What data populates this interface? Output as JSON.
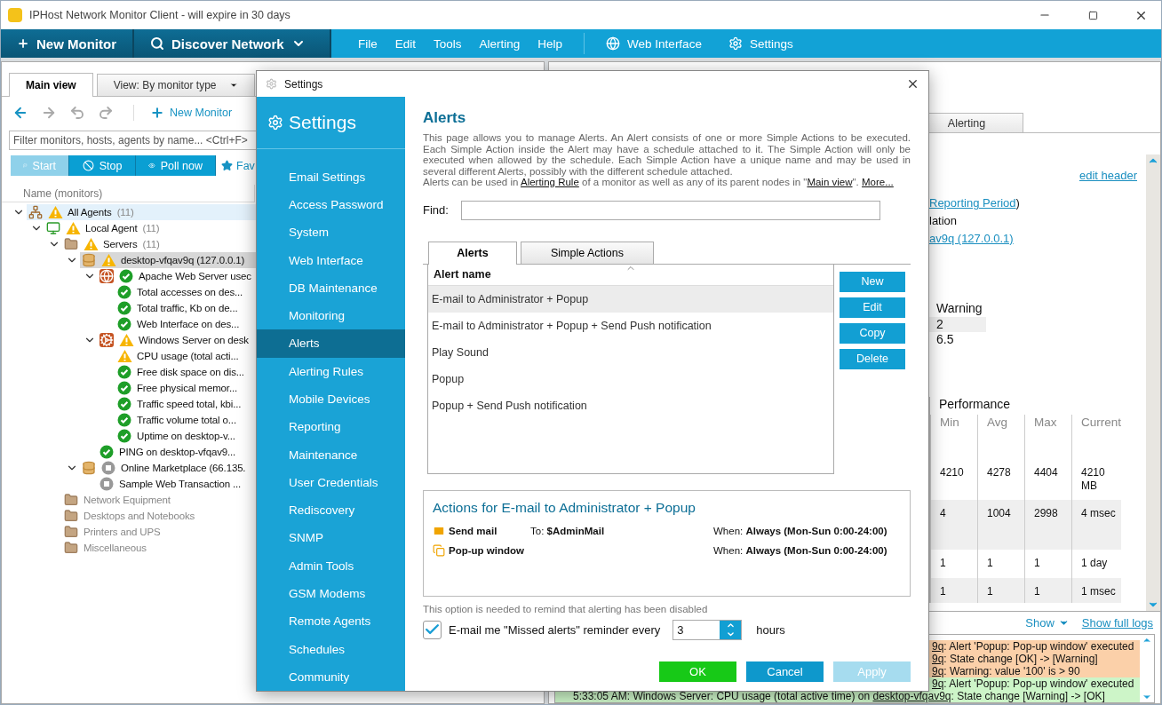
{
  "window": {
    "title": "IPHost Network Monitor Client - will expire in 30 days"
  },
  "toolbar": {
    "primary": [
      {
        "label": "New Monitor",
        "kind": "add"
      },
      {
        "label": "Discover Network",
        "kind": "discover"
      }
    ],
    "menu": [
      "File",
      "Edit",
      "Tools",
      "Alerting",
      "Help"
    ],
    "links": [
      {
        "label": "Web Interface",
        "kind": "globe"
      },
      {
        "label": "Settings",
        "kind": "gear"
      }
    ]
  },
  "left_panel": {
    "tabs": [
      {
        "label": "Main view",
        "selected": true,
        "kind": "tab"
      },
      {
        "label": "View: By monitor type",
        "selected": false,
        "kind": "dropdown"
      }
    ],
    "nav_buttons": [
      {
        "kind": "back",
        "disabled": false
      },
      {
        "kind": "forward",
        "disabled": true
      },
      {
        "kind": "undo",
        "disabled": true
      },
      {
        "kind": "redo",
        "disabled": true
      }
    ],
    "new_monitor": "New Monitor",
    "filter": {
      "placeholder": "Filter monitors, hosts, agents by name... <Ctrl+F>"
    },
    "actions": [
      {
        "label": "Start",
        "kind": "start",
        "disabled": true
      },
      {
        "label": "Stop",
        "kind": "stop",
        "disabled": false
      },
      {
        "label": "Poll now",
        "kind": "poll",
        "disabled": false
      }
    ],
    "favorites": "Fav",
    "column": "Name (monitors)",
    "tree": [
      {
        "label": "All Agents",
        "count": "(11)",
        "kind": "agents",
        "status": {
          "kind": "warning",
          "color": "#f7b500"
        },
        "expanded": true,
        "selected": false,
        "hovered": true,
        "disabled": false,
        "children": [
          {
            "label": "Local Agent",
            "count": "(11)",
            "kind": "agent",
            "status": {
              "kind": "warning",
              "color": "#f7b500"
            },
            "expanded": true,
            "selected": false,
            "hovered": false,
            "disabled": false,
            "children": [
              {
                "label": "Servers",
                "count": "(11)",
                "kind": "folder",
                "status": {
                  "kind": "warning",
                  "color": "#f7b500"
                },
                "expanded": true,
                "selected": false,
                "hovered": false,
                "disabled": false,
                "children": [
                  {
                    "label": "desktop-vfqav9q (127.0.0.1)",
                    "kind": "host",
                    "status": {
                      "kind": "warning",
                      "color": "#f7b500"
                    },
                    "expanded": true,
                    "selected": true,
                    "hovered": false,
                    "disabled": false,
                    "children": [
                      {
                        "label": "Apache Web Server usec",
                        "kind": "web",
                        "status": {
                          "kind": "ok",
                          "color": "#1e9e28"
                        },
                        "expanded": true,
                        "selected": false,
                        "hovered": false,
                        "disabled": false,
                        "children": [
                          {
                            "label": "Total accesses on des...",
                            "kind": "monitor",
                            "status": {
                              "kind": "ok",
                              "color": "#1e9e28"
                            },
                            "selected": false,
                            "hovered": false,
                            "disabled": false
                          },
                          {
                            "label": "Total traffic, Kb on de...",
                            "kind": "monitor",
                            "status": {
                              "kind": "ok",
                              "color": "#1e9e28"
                            },
                            "selected": false,
                            "hovered": false,
                            "disabled": false
                          },
                          {
                            "label": "Web Interface on des...",
                            "kind": "monitor",
                            "status": {
                              "kind": "ok",
                              "color": "#1e9e28"
                            },
                            "selected": false,
                            "hovered": false,
                            "disabled": false
                          }
                        ]
                      },
                      {
                        "label": "Windows Server on desk",
                        "kind": "windows",
                        "status": {
                          "kind": "warning",
                          "color": "#f7b500"
                        },
                        "expanded": true,
                        "selected": false,
                        "hovered": false,
                        "disabled": false,
                        "children": [
                          {
                            "label": "CPU usage (total acti...",
                            "kind": "monitor",
                            "status": {
                              "kind": "warning",
                              "color": "#f7b500"
                            },
                            "selected": false,
                            "hovered": false,
                            "disabled": false
                          },
                          {
                            "label": "Free disk space on dis...",
                            "kind": "monitor",
                            "status": {
                              "kind": "ok",
                              "color": "#1e9e28"
                            },
                            "selected": false,
                            "hovered": false,
                            "disabled": false
                          },
                          {
                            "label": "Free physical memor...",
                            "kind": "monitor",
                            "status": {
                              "kind": "ok",
                              "color": "#1e9e28"
                            },
                            "selected": false,
                            "hovered": false,
                            "disabled": false
                          },
                          {
                            "label": "Traffic speed total, kbi...",
                            "kind": "monitor",
                            "status": {
                              "kind": "ok",
                              "color": "#1e9e28"
                            },
                            "selected": false,
                            "hovered": false,
                            "disabled": false
                          },
                          {
                            "label": "Traffic volume total o...",
                            "kind": "monitor",
                            "status": {
                              "kind": "ok",
                              "color": "#1e9e28"
                            },
                            "selected": false,
                            "hovered": false,
                            "disabled": false
                          },
                          {
                            "label": "Uptime on desktop-v...",
                            "kind": "monitor",
                            "status": {
                              "kind": "ok",
                              "color": "#1e9e28"
                            },
                            "selected": false,
                            "hovered": false,
                            "disabled": false
                          }
                        ]
                      },
                      {
                        "label": "PING on desktop-vfqav9...",
                        "kind": "monitor",
                        "status": {
                          "kind": "ok",
                          "color": "#1e9e28"
                        },
                        "selected": false,
                        "hovered": false,
                        "disabled": false
                      }
                    ]
                  },
                  {
                    "label": "Online Marketplace (66.135.",
                    "kind": "host",
                    "status": {
                      "kind": "unknown",
                      "color": "#999999"
                    },
                    "expanded": true,
                    "selected": false,
                    "hovered": false,
                    "disabled": false,
                    "children": [
                      {
                        "label": "Sample Web Transaction ...",
                        "kind": "monitor",
                        "status": {
                          "kind": "unknown",
                          "color": "#999999"
                        },
                        "selected": false,
                        "hovered": false,
                        "disabled": false
                      }
                    ]
                  }
                ]
              },
              {
                "label": "Network Equipment",
                "kind": "folder",
                "selected": false,
                "hovered": false,
                "disabled": true
              },
              {
                "label": "Desktops and Notebooks",
                "kind": "folder",
                "selected": false,
                "hovered": false,
                "disabled": true
              },
              {
                "label": "Printers and UPS",
                "kind": "folder",
                "selected": false,
                "hovered": false,
                "disabled": true
              },
              {
                "label": "Miscellaneous",
                "kind": "folder",
                "selected": false,
                "hovered": false,
                "disabled": true
              }
            ]
          }
        ]
      }
    ]
  },
  "right_panel": {
    "tabs": [
      {
        "label": "Alerting",
        "selected": false
      }
    ],
    "edit_header": "edit header",
    "lines": [
      {
        "link": "Reporting Period",
        "text": ")"
      },
      {
        "text": "lation"
      },
      {
        "link": "av9q (127.0.0.1)"
      }
    ],
    "thresholds": {
      "heading": "Warning",
      "values": [
        "2",
        "6.5"
      ]
    },
    "performance": {
      "title": "Performance",
      "columns": [
        "Min",
        "Avg",
        "Max",
        "Current"
      ],
      "rows": [
        [
          "4210",
          "4278",
          "4404",
          "4210 MB"
        ],
        [
          "4",
          "1004",
          "2998",
          "4 msec"
        ],
        [
          "1",
          "1",
          "1",
          "1 day"
        ],
        [
          "1",
          "1",
          "1",
          "1 msec"
        ]
      ]
    },
    "logs": {
      "show": "Show",
      "full": "Show full logs",
      "entries": [
        {
          "kind": "warning",
          "link": "9q",
          "text": ": Alert 'Popup: Pop-up window' executed"
        },
        {
          "kind": "warning",
          "link": "9q",
          "text": ": State change [OK] -> [Warning]"
        },
        {
          "kind": "warning",
          "link": "9q",
          "text": ": Warning: value '100' is > 90"
        },
        {
          "kind": "ok",
          "link": "9q",
          "text": ": Alert 'Popup: Pop-up window' executed"
        },
        {
          "kind": "ok",
          "prefix": "5:33:05 AM: Windows Server: CPU usage (total active time) on ",
          "link": "desktop-vfqav9q",
          "text": ": State change [Warning] -> [OK]"
        }
      ]
    }
  },
  "dialog": {
    "title": "Settings",
    "sidebar": {
      "title": "Settings",
      "items": [
        {
          "label": "Email Settings",
          "selected": false
        },
        {
          "label": "Access Password",
          "selected": false
        },
        {
          "label": "System",
          "selected": false
        },
        {
          "label": "Web Interface",
          "selected": false
        },
        {
          "label": "DB Maintenance",
          "selected": false
        },
        {
          "label": "Monitoring",
          "selected": false
        },
        {
          "label": "Alerts",
          "selected": true
        },
        {
          "label": "Alerting Rules",
          "selected": false
        },
        {
          "label": "Mobile Devices",
          "selected": false
        },
        {
          "label": "Reporting",
          "selected": false
        },
        {
          "label": "Maintenance",
          "selected": false
        },
        {
          "label": "User Credentials",
          "selected": false
        },
        {
          "label": "Rediscovery",
          "selected": false
        },
        {
          "label": "SNMP",
          "selected": false
        },
        {
          "label": "Admin Tools",
          "selected": false
        },
        {
          "label": "GSM Modems",
          "selected": false
        },
        {
          "label": "Remote Agents",
          "selected": false
        },
        {
          "label": "Schedules",
          "selected": false
        },
        {
          "label": "Community",
          "selected": false
        }
      ]
    },
    "heading": "Alerts",
    "description": "This page allows you to manage Alerts. An Alert consists of one or more Simple Actions to be executed. Each Simple Action inside the Alert may have a schedule attached to it. The Simple Action will only be executed when allowed by the schedule. Each Simple Action have a unique name and may be used in several different Alerts, possibly with the different schedule attached.",
    "usage": [
      {
        "text": "Alerts can be used in "
      },
      {
        "link": "Alerting Rule"
      },
      {
        "text": " of a monitor as well as any of its parent nodes in \""
      },
      {
        "link": "Main view"
      },
      {
        "text": "\". "
      },
      {
        "link": "More..."
      }
    ],
    "find_label": "Find:",
    "tabs": [
      {
        "label": "Alerts",
        "selected": true
      },
      {
        "label": "Simple Actions",
        "selected": false
      }
    ],
    "table": {
      "columns": [
        "Alert name"
      ],
      "rows": [
        {
          "name": "E-mail to Administrator + Popup",
          "selected": true
        },
        {
          "name": "E-mail to Administrator + Popup + Send Push notification",
          "selected": false
        },
        {
          "name": "Play Sound",
          "selected": false
        },
        {
          "name": "Popup",
          "selected": false
        },
        {
          "name": "Popup + Send Push notification",
          "selected": false
        }
      ]
    },
    "buttons": [
      "New",
      "Edit",
      "Copy",
      "Delete"
    ],
    "actions": {
      "title": "Actions for E-mail to Administrator + Popup",
      "items": [
        {
          "kind": "mail",
          "name": "Send mail",
          "target_label": "To:",
          "target": "$AdminMail",
          "when_label": "When:",
          "when": "Always (Mon-Sun 0:00-24:00)"
        },
        {
          "kind": "popup",
          "name": "Pop-up window",
          "when_label": "When:",
          "when": "Always (Mon-Sun 0:00-24:00)"
        }
      ]
    },
    "reminder": {
      "note": "This option is needed to remind that alerting has been disabled",
      "checked": true,
      "label": "E-mail me \"Missed alerts\" reminder every",
      "value": "3",
      "unit": "hours"
    },
    "footer": [
      {
        "label": "OK",
        "kind": "primary",
        "disabled": false
      },
      {
        "label": "Cancel",
        "kind": "secondary",
        "disabled": false
      },
      {
        "label": "Apply",
        "kind": "secondary",
        "disabled": true
      }
    ]
  }
}
